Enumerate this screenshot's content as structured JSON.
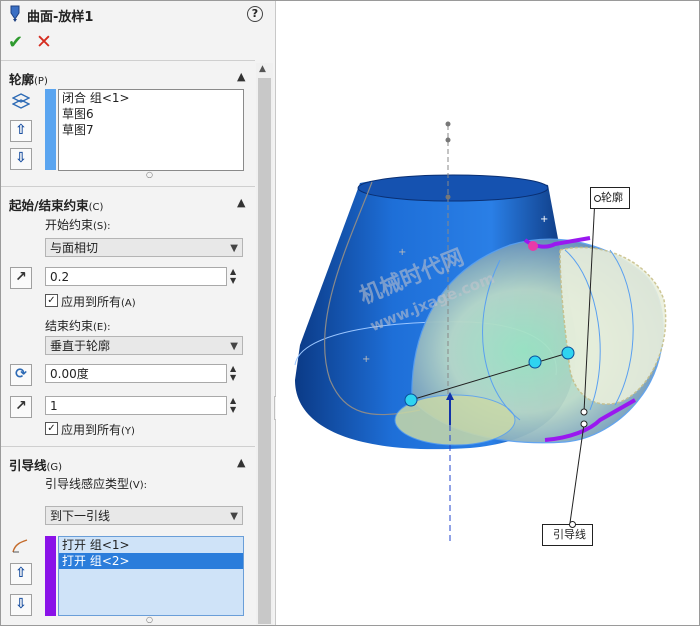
{
  "header": {
    "title": "曲面-放样1",
    "help_glyph": "?"
  },
  "actions": {
    "ok_glyph": "✔",
    "cancel_glyph": "✕"
  },
  "profiles": {
    "title": "轮廓",
    "shortcut": "(P)",
    "items": [
      "闭合 组<1>",
      "草图6",
      "草图7"
    ],
    "bar_color": "#5aa5f0"
  },
  "constraints": {
    "title": "起始/结束约束",
    "shortcut": "(C)",
    "start_label": "开始约束",
    "start_shortcut": "(S):",
    "start_value": "与面相切",
    "start_length": "0.2",
    "apply_all_label": "应用到所有",
    "apply_all_shortcut_a": "(A)",
    "end_label": "结束约束",
    "end_shortcut": "(E):",
    "end_value": "垂直于轮廓",
    "end_angle": "0.00度",
    "end_length": "1",
    "apply_all_shortcut_y": "(Y)"
  },
  "guides": {
    "title": "引导线",
    "shortcut": "(G)",
    "influence_label": "引导线感应类型",
    "influence_shortcut": "(V):",
    "influence_value": "到下一引线",
    "items": [
      "打开 组<1>",
      "打开 组<2>"
    ],
    "selected_index": 1,
    "bar_color": "#8a12e8"
  },
  "viewport": {
    "callout_profile": "轮廓",
    "callout_guide": "引导线",
    "watermark_cn": "机械时代网",
    "watermark_url": "www.jxage.com"
  }
}
